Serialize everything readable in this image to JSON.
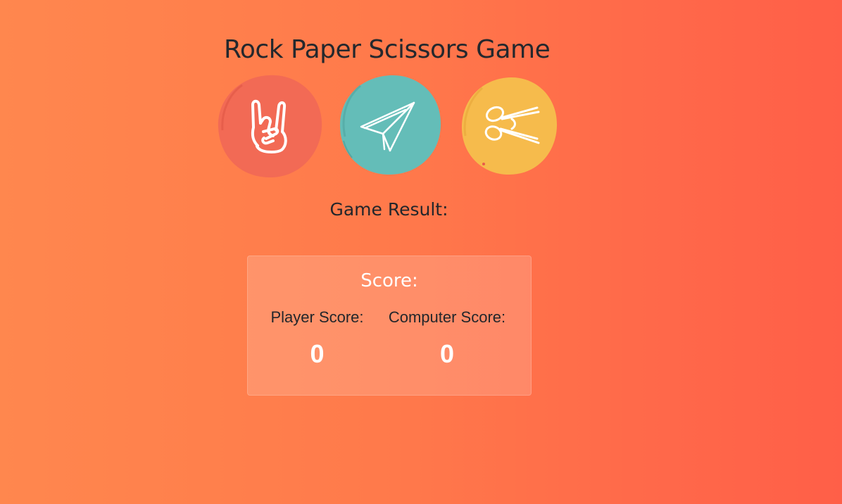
{
  "game": {
    "title": "Rock Paper Scissors Game",
    "choices": [
      {
        "id": "rock",
        "icon": "rock-hand-icon",
        "color": "#f26a55"
      },
      {
        "id": "paper",
        "icon": "paper-plane-icon",
        "color": "#64bdb8"
      },
      {
        "id": "scissors",
        "icon": "scissors-icon",
        "color": "#f6bb4c"
      }
    ],
    "result_label": "Game Result:"
  },
  "score": {
    "heading": "Score:",
    "player_label": "Player Score:",
    "player_value": "0",
    "computer_label": "Computer Score:",
    "computer_value": "0"
  }
}
